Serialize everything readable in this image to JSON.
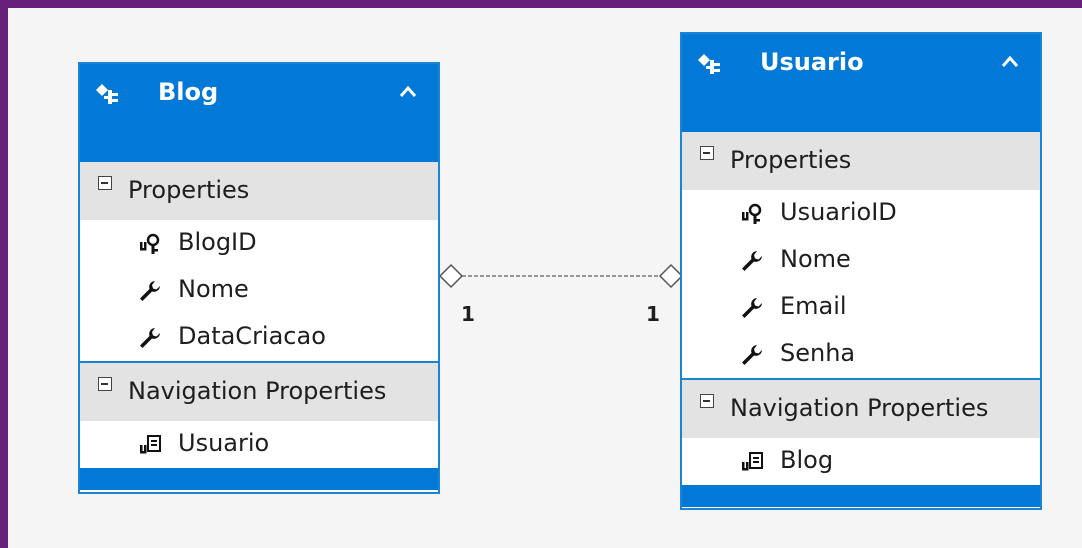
{
  "entities": {
    "blog": {
      "title": "Blog",
      "properties_label": "Properties",
      "properties": [
        "BlogID",
        "Nome",
        "DataCriacao"
      ],
      "navigation_label": "Navigation Properties",
      "navigation": [
        "Usuario"
      ]
    },
    "usuario": {
      "title": "Usuario",
      "properties_label": "Properties",
      "properties": [
        "UsuarioID",
        "Nome",
        "Email",
        "Senha"
      ],
      "navigation_label": "Navigation Properties",
      "navigation": [
        "Blog"
      ]
    }
  },
  "association": {
    "left_multiplicity": "1",
    "right_multiplicity": "1"
  },
  "colors": {
    "header": "#0278d7",
    "border": "#1a83d2",
    "section": "#e3e3e3",
    "background": "#f5f5f5",
    "frame": "#68217a"
  },
  "icons": {
    "entity": "entity-icon",
    "key": "key-property-icon",
    "property": "wrench-property-icon",
    "navigation": "navigation-property-icon",
    "collapse": "chevron-up-icon",
    "section": "minus-box-icon"
  }
}
